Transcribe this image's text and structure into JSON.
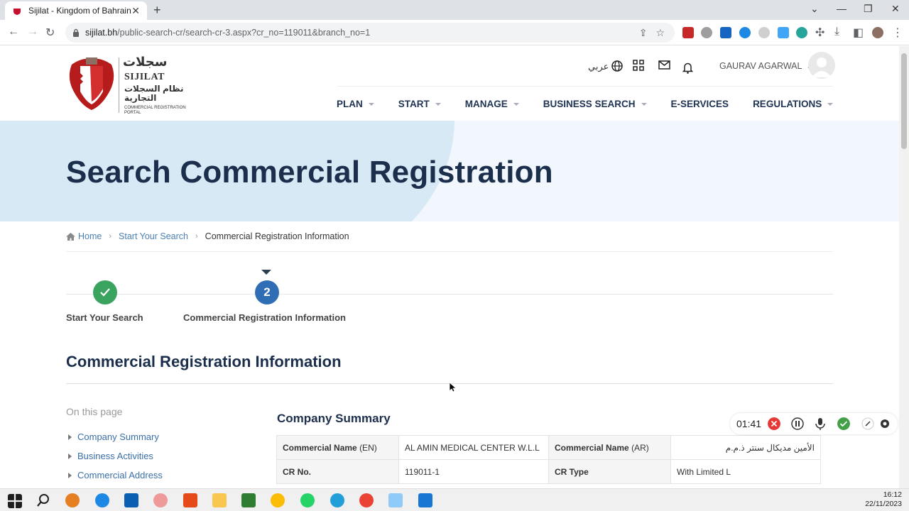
{
  "browser": {
    "tab_title": "Sijilat - Kingdom of Bahrain",
    "url_host": "sijilat.bh",
    "url_path": "/public-search-cr/search-cr-3.aspx?cr_no=119011&branch_no=1"
  },
  "header": {
    "logo": {
      "arabic_title": "سجلات",
      "english_title": "SIJILAT",
      "arabic_subtitle": "نظام السجلات التجارية",
      "english_subtitle": "COMMERCIAL REGISTRATION PORTAL"
    },
    "language_label": "عربي",
    "user_name": "GAURAV AGARWAL",
    "nav": [
      {
        "label": "PLAN",
        "has_dropdown": true
      },
      {
        "label": "START",
        "has_dropdown": true
      },
      {
        "label": "MANAGE",
        "has_dropdown": true
      },
      {
        "label": "BUSINESS SEARCH",
        "has_dropdown": true
      },
      {
        "label": "E-SERVICES",
        "has_dropdown": false
      },
      {
        "label": "REGULATIONS",
        "has_dropdown": true
      }
    ]
  },
  "hero": {
    "title": "Search Commercial Registration"
  },
  "breadcrumb": {
    "home": "Home",
    "step": "Start Your Search",
    "current": "Commercial Registration Information"
  },
  "steps": [
    {
      "label": "Start Your Search",
      "status": "done"
    },
    {
      "number": "2",
      "label": "Commercial Registration Information",
      "status": "active"
    }
  ],
  "main": {
    "section_title": "Commercial Registration Information",
    "on_this_page": "On this page",
    "toc": [
      "Company Summary",
      "Business Activities",
      "Commercial Address"
    ],
    "company_summary": {
      "title": "Company Summary",
      "rows": [
        {
          "label1": "Commercial Name",
          "suffix1": "(EN)",
          "value1": "AL AMIN MEDICAL CENTER W.L.L",
          "label2": "Commercial Name",
          "suffix2": "(AR)",
          "value2": "الأمين مديكال سنتر ذ.م.م"
        },
        {
          "label1": "CR No.",
          "suffix1": "",
          "value1": "119011-1",
          "label2": "CR Type",
          "suffix2": "",
          "value2": "With Limited L"
        }
      ]
    }
  },
  "recorder": {
    "time": "01:41"
  },
  "taskbar": {
    "time": "16:12",
    "date": "22/11/2023"
  },
  "colors": {
    "primary_dark": "#1b2f4d",
    "link": "#3a6fa8",
    "step_done": "#3aa35f",
    "step_active": "#2f6eb5"
  }
}
